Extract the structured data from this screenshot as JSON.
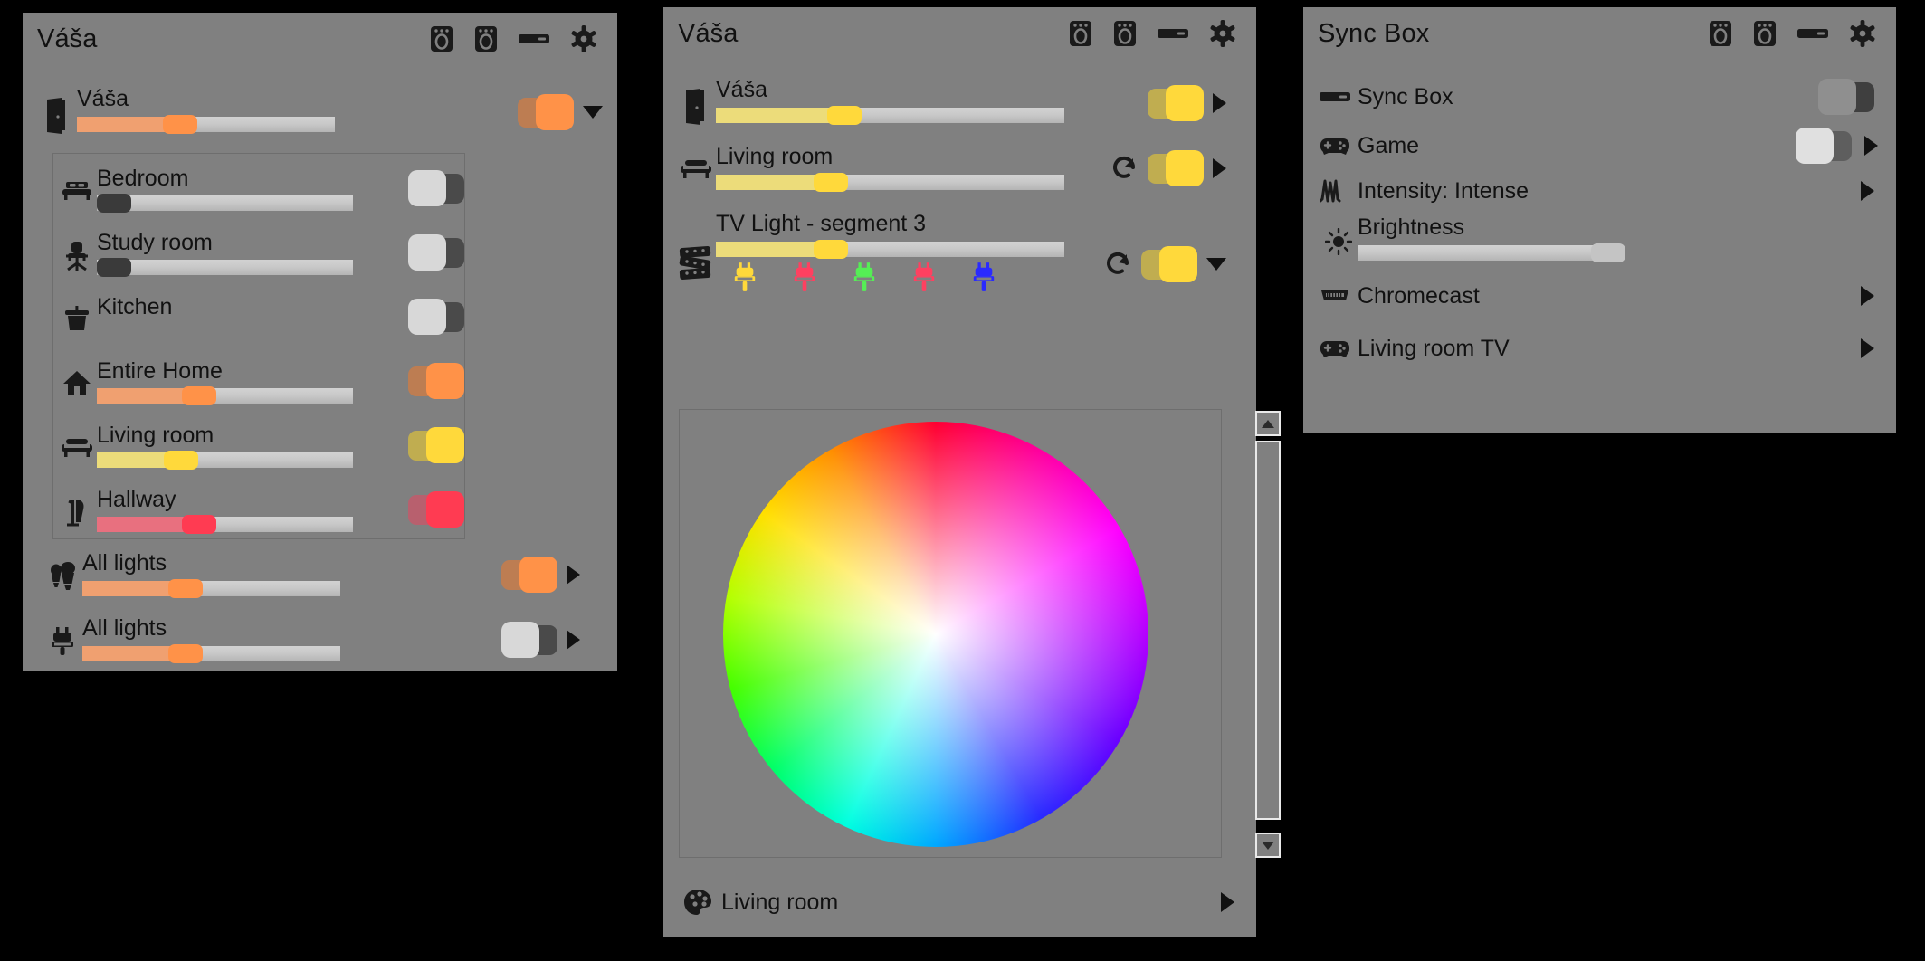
{
  "panels": {
    "left": {
      "title": "Váša",
      "header_icons": [
        "speaker-icon",
        "speaker-icon",
        "sync-box-icon",
        "gear-icon"
      ],
      "main_row": {
        "label": "Váša",
        "icon": "door-icon",
        "slider_value": 40,
        "slider_color": "#ff9248",
        "toggle_state": "on",
        "toggle_color": "#ff9248",
        "trailing": "caret-down"
      },
      "rooms": [
        {
          "label": "Bedroom",
          "icon": "bed-icon",
          "has_slider": true,
          "slider_value": 0,
          "slider_color": "#3a3a3a",
          "toggle_state": "off"
        },
        {
          "label": "Study room",
          "icon": "office-chair-icon",
          "has_slider": true,
          "slider_value": 0,
          "slider_color": "#3a3a3a",
          "toggle_state": "off"
        },
        {
          "label": "Kitchen",
          "icon": "cooking-pot-icon",
          "has_slider": false,
          "slider_value": 0,
          "slider_color": "#3a3a3a",
          "toggle_state": "off"
        },
        {
          "label": "Entire Home",
          "icon": "home-icon",
          "has_slider": true,
          "slider_value": 40,
          "slider_color": "#ff9248",
          "toggle_state": "on"
        },
        {
          "label": "Living room",
          "icon": "sofa-icon",
          "has_slider": true,
          "slider_value": 33,
          "slider_color": "#ffd93b",
          "toggle_state": "on"
        },
        {
          "label": "Hallway",
          "icon": "coat-rack-icon",
          "has_slider": true,
          "slider_value": 40,
          "slider_color": "#ff3b52",
          "toggle_state": "on"
        }
      ],
      "groups": [
        {
          "label": "All lights",
          "icon": "bulbs-icon",
          "slider_value": 40,
          "slider_color": "#ff9248",
          "toggle_state": "on",
          "toggle_color": "#ff9248",
          "trailing": "caret-right"
        },
        {
          "label": "All lights",
          "icon": "plug-icon",
          "slider_value": 40,
          "slider_color": "#ff9248",
          "toggle_state": "off",
          "toggle_color": "#d8d8d8",
          "trailing": "caret-right"
        }
      ]
    },
    "middle": {
      "title": "Váša",
      "header_icons": [
        "speaker-icon",
        "speaker-icon",
        "sync-box-icon",
        "gear-icon"
      ],
      "rows": [
        {
          "label": "Váša",
          "icon": "door-icon",
          "slider_value": 37,
          "slider_color": "#ffd93b",
          "toggle_state": "on",
          "toggle_color": "#ffd93b",
          "has_refresh": false,
          "trailing": "caret-right"
        },
        {
          "label": "Living room",
          "icon": "sofa-icon",
          "slider_value": 33,
          "slider_color": "#ffd93b",
          "toggle_state": "on",
          "toggle_color": "#ffd93b",
          "has_refresh": true,
          "trailing": "caret-right"
        },
        {
          "label": "TV Light - segment 3",
          "icon": "led-strip-icon",
          "slider_value": 33,
          "slider_color": "#ffd93b",
          "toggle_state": "on",
          "toggle_color": "#ffd93b",
          "has_refresh": true,
          "trailing": "caret-down"
        }
      ],
      "segments": [
        {
          "name": "segment-1",
          "color": "#ffd93b"
        },
        {
          "name": "segment-2",
          "color": "#ff4060"
        },
        {
          "name": "segment-3",
          "color": "#55ee55"
        },
        {
          "name": "segment-4",
          "color": "#ff4060"
        },
        {
          "name": "segment-5",
          "color": "#2a2aff"
        }
      ],
      "color_picker": {
        "name": "color-wheel",
        "scrollbar": "vertical-scrollbar"
      },
      "footer": {
        "label": "Living room",
        "icon": "palette-icon",
        "trailing": "caret-right"
      }
    },
    "right": {
      "title": "Sync Box",
      "header_icons": [
        "speaker-icon",
        "speaker-icon",
        "sync-box-icon",
        "gear-icon"
      ],
      "rows": [
        {
          "label": "Sync Box",
          "icon": "sync-box-icon",
          "type": "toggle",
          "toggle_state": "off",
          "knob_color": "#8f8f8f",
          "track_color": "#3f3f3f",
          "trailing": "none"
        },
        {
          "label": "Game",
          "icon": "gamepad-icon",
          "type": "toggle",
          "toggle_state": "off",
          "knob_color": "#e0e0e0",
          "track_color": "#5e5e5e",
          "trailing": "caret-right"
        },
        {
          "label": "Intensity: Intense",
          "icon": "waveform-icon",
          "type": "link",
          "trailing": "caret-right"
        },
        {
          "label": "Brightness",
          "icon": "brightness-icon",
          "type": "slider",
          "slider_value": 97,
          "slider_color": "#c4c4c4",
          "trailing": "none"
        },
        {
          "label": "Chromecast",
          "icon": "hdmi-icon",
          "type": "link",
          "trailing": "caret-right"
        },
        {
          "label": "Living room TV",
          "icon": "gamepad-icon",
          "type": "link",
          "trailing": "caret-right"
        }
      ]
    }
  },
  "colors": {
    "panel_bg": "#808080",
    "page_bg": "#000000",
    "text": "#111111",
    "orange": "#ff9248",
    "yellow": "#ffd93b",
    "red": "#ff3b52",
    "toggle_off_knob": "#d8d8d8",
    "toggle_off_track": "#4a4a4a"
  }
}
